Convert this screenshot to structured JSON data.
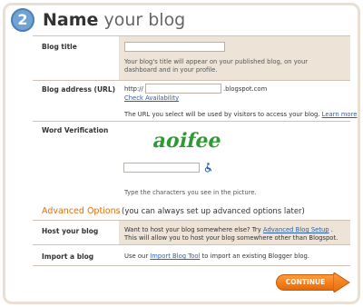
{
  "header": {
    "step_number": "2",
    "title_bold": "Name",
    "title_rest": " your blog"
  },
  "blog_title": {
    "label": "Blog title",
    "value": "",
    "help": "Your blog's title will appear on your published blog, on your dashboard and in your profile."
  },
  "blog_address": {
    "label": "Blog address (URL)",
    "prefix": "http://",
    "value": "",
    "suffix": ".blogspot.com",
    "check_link": "Check Availability",
    "help_text": "The URL you select will be used by visitors to access your blog.",
    "learn_more": "Learn more"
  },
  "word_verification": {
    "label": "Word Verification",
    "captcha_text": "aoifee",
    "value": "",
    "help": "Type the characters you see in the picture.",
    "accessibility_icon": "wheelchair-icon"
  },
  "advanced": {
    "title": "Advanced Options",
    "subtitle": "(you can always set up advanced options later)",
    "host": {
      "label": "Host your blog",
      "text_before": "Want to host your blog somewhere else? Try",
      "link": "Advanced Blog Setup",
      "text_after": ". This will allow you to host your blog somewhere other than Blogspot."
    },
    "import": {
      "label": "Import a blog",
      "text_before": "Use our",
      "link": "Import Blog Tool",
      "text_after": "to import an existing Blogger blog."
    }
  },
  "continue_button": {
    "label": "CONTINUE",
    "color": "#f07a10"
  },
  "colors": {
    "accent": "#e06f12",
    "link": "#2a5db0",
    "shade": "#ede4d7",
    "step_circle": "#6fa3d6"
  }
}
